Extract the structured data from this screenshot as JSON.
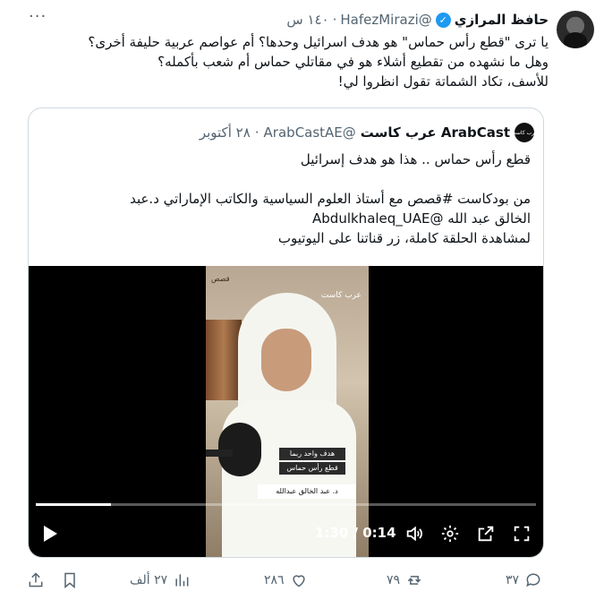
{
  "tweet": {
    "name": "حافظ المرازي",
    "handle": "@HafezMirazi",
    "time": "١٤٠ س",
    "lines": [
      "يا ترى \"قطع رأس حماس\" هو هدف اسرائيل وحدها؟ أم عواصم عربية حليفة أخرى؟",
      "وهل ما نشهده من تقطيع أشلاء هو في مقاتلي حماس أم شعب بأكمله؟",
      "للأسف، تكاد الشماتة تقول انظروا لي!"
    ],
    "more_icon": "more-dots-icon",
    "verified_icon": "verified-badge-icon"
  },
  "quote": {
    "name": "ArabCast عرب كاست",
    "handle": "@ArabCastAE",
    "time": "٢٨ أكتوبر",
    "avatar_text": "عرب كاست",
    "lines": [
      "قطع رأس حماس .. هذا هو هدف إسرائيل",
      "",
      "من بودكاست #قصص مع أستاذ العلوم السياسية والكاتب الإماراتي د.عبد",
      "الخالق عبد الله @Abdulkhaleq_UAE",
      "لمشاهدة الحلقة كاملة، زر قناتنا على اليوتيوب"
    ]
  },
  "video": {
    "time_display": "1:30 / 0:14",
    "progress_fraction": 0.15,
    "overlay_top": "قصص",
    "channel_logo": "عرب كاست",
    "banner1": "هدف واحد ربما",
    "banner2": "قطع رأس حماس",
    "name_plate": "د. عبد الخالق عبدالله"
  },
  "actions": {
    "replies": "٣٧",
    "retweets": "٧٩",
    "likes": "٢٨٦",
    "views": "٢٧ ألف"
  },
  "colors": {
    "accent": "#1d9bf0",
    "muted": "#536471",
    "border": "#cfd9de"
  }
}
